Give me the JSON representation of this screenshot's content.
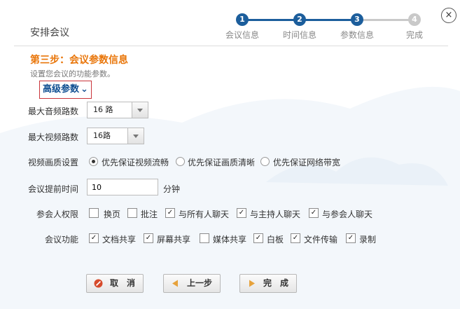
{
  "header": {
    "title": "安排会议",
    "close_symbol": "×"
  },
  "steps": [
    {
      "number": "1",
      "label": "会议信息",
      "state": "done"
    },
    {
      "number": "2",
      "label": "时间信息",
      "state": "done"
    },
    {
      "number": "3",
      "label": "参数信息",
      "state": "done"
    },
    {
      "number": "4",
      "label": "完成",
      "state": "todo"
    }
  ],
  "section": {
    "title": "第三步：会议参数信息",
    "desc": "设置您会议的功能参数。"
  },
  "advanced": {
    "label": "高级参数",
    "chevron": "⌄"
  },
  "form": {
    "max_audio": {
      "label": "最大音频路数",
      "value": "16 路"
    },
    "max_video": {
      "label": "最大视频路数",
      "value": "16路"
    },
    "video_quality": {
      "label": "视频画质设置",
      "options": [
        {
          "label": "优先保证视频流畅",
          "selected": true
        },
        {
          "label": "优先保证画质清晰",
          "selected": false
        },
        {
          "label": "优先保证网络带宽",
          "selected": false
        }
      ]
    },
    "advance_time": {
      "label": "会议提前时间",
      "value": "10",
      "unit": "分钟"
    },
    "permissions": {
      "label": "参会人权限",
      "options": [
        {
          "label": "换页",
          "checked": false
        },
        {
          "label": "批注",
          "checked": false
        },
        {
          "label": "与所有人聊天",
          "checked": true
        },
        {
          "label": "与主持人聊天",
          "checked": true
        },
        {
          "label": "与参会人聊天",
          "checked": true
        }
      ]
    },
    "features": {
      "label": "会议功能",
      "options": [
        {
          "label": "文档共享",
          "checked": true
        },
        {
          "label": "屏幕共享",
          "checked": true
        },
        {
          "label": "媒体共享",
          "checked": false
        },
        {
          "label": "白板",
          "checked": true
        },
        {
          "label": "文件传输",
          "checked": true
        },
        {
          "label": "录制",
          "checked": true
        }
      ]
    }
  },
  "footer": {
    "cancel": "取　消",
    "prev": "上一步",
    "finish": "完　成"
  },
  "colors": {
    "accent_orange": "#e9760a",
    "step_blue": "#1c5e9c",
    "link_blue": "#0f4e91",
    "highlight_red": "#c9343a"
  }
}
